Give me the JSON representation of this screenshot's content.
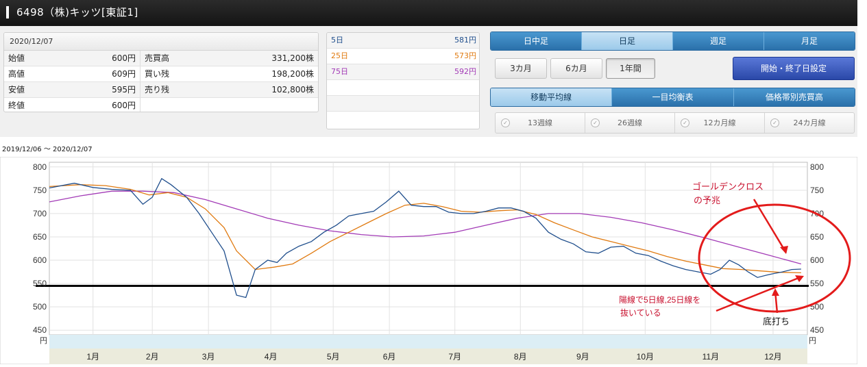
{
  "header": {
    "title": "6498（株)キッツ[東証1]"
  },
  "prices": {
    "date": "2020/12/07",
    "rows": [
      {
        "label": "始値",
        "value": "600円",
        "label2": "売買高",
        "value2": "331,200株"
      },
      {
        "label": "高値",
        "value": "609円",
        "label2": "買い残",
        "value2": "198,200株"
      },
      {
        "label": "安値",
        "value": "595円",
        "label2": "売り残",
        "value2": "102,800株"
      },
      {
        "label": "終値",
        "value": "600円",
        "label2": "",
        "value2": ""
      }
    ]
  },
  "ma_box": {
    "rows": [
      {
        "label": "5日",
        "value": "581円",
        "color": "#1f4e8c"
      },
      {
        "label": "25日",
        "value": "573円",
        "color": "#e07a10"
      },
      {
        "label": "75日",
        "value": "592円",
        "color": "#a23ab6"
      }
    ]
  },
  "period_tabs": [
    {
      "label": "日中足",
      "active": false
    },
    {
      "label": "日足",
      "active": true
    },
    {
      "label": "週足",
      "active": false
    },
    {
      "label": "月足",
      "active": false
    }
  ],
  "range_buttons": [
    {
      "label": "3カ月",
      "active": false
    },
    {
      "label": "6カ月",
      "active": false
    },
    {
      "label": "1年間",
      "active": true
    }
  ],
  "set_button": "開始・終了日設定",
  "indicator_tabs": [
    {
      "label": "移動平均線",
      "active": true
    },
    {
      "label": "一目均衡表",
      "active": false
    },
    {
      "label": "価格帯別売買高",
      "active": false
    }
  ],
  "checkboxes": [
    "13週線",
    "26週線",
    "12カ月線",
    "24カ月線"
  ],
  "range_text": "2019/12/06 〜 2020/12/07",
  "chart_data": {
    "type": "line",
    "unit": "円",
    "ylim": [
      440,
      810
    ],
    "yticks": [
      450,
      500,
      550,
      600,
      650,
      700,
      750,
      800
    ],
    "months": [
      "1月",
      "2月",
      "3月",
      "4月",
      "5月",
      "6月",
      "7月",
      "8月",
      "9月",
      "10月",
      "11月",
      "12月"
    ],
    "month_index": [
      14,
      33,
      51,
      71,
      91,
      109,
      130,
      151,
      171,
      191,
      212,
      232
    ],
    "total_days": 243,
    "horizontal_line": 545,
    "series": [
      {
        "name": "5日",
        "color": "#1f4e8c",
        "points": [
          [
            0,
            755
          ],
          [
            8,
            765
          ],
          [
            14,
            756
          ],
          [
            20,
            752
          ],
          [
            26,
            750
          ],
          [
            30,
            720
          ],
          [
            33,
            735
          ],
          [
            36,
            775
          ],
          [
            39,
            762
          ],
          [
            44,
            735
          ],
          [
            48,
            700
          ],
          [
            52,
            660
          ],
          [
            56,
            620
          ],
          [
            60,
            525
          ],
          [
            63,
            520
          ],
          [
            66,
            580
          ],
          [
            70,
            600
          ],
          [
            73,
            595
          ],
          [
            76,
            615
          ],
          [
            80,
            630
          ],
          [
            84,
            640
          ],
          [
            88,
            660
          ],
          [
            92,
            675
          ],
          [
            96,
            695
          ],
          [
            100,
            700
          ],
          [
            104,
            705
          ],
          [
            108,
            725
          ],
          [
            112,
            748
          ],
          [
            116,
            718
          ],
          [
            120,
            715
          ],
          [
            124,
            715
          ],
          [
            128,
            703
          ],
          [
            132,
            700
          ],
          [
            136,
            700
          ],
          [
            140,
            705
          ],
          [
            144,
            712
          ],
          [
            148,
            712
          ],
          [
            152,
            705
          ],
          [
            156,
            690
          ],
          [
            160,
            660
          ],
          [
            164,
            645
          ],
          [
            168,
            635
          ],
          [
            172,
            618
          ],
          [
            176,
            615
          ],
          [
            180,
            628
          ],
          [
            184,
            630
          ],
          [
            188,
            615
          ],
          [
            192,
            610
          ],
          [
            196,
            598
          ],
          [
            200,
            588
          ],
          [
            204,
            580
          ],
          [
            208,
            575
          ],
          [
            212,
            570
          ],
          [
            215,
            580
          ],
          [
            218,
            600
          ],
          [
            221,
            590
          ],
          [
            224,
            575
          ],
          [
            227,
            563
          ],
          [
            230,
            568
          ],
          [
            232,
            571
          ],
          [
            235,
            575
          ],
          [
            238,
            580
          ],
          [
            241,
            581
          ]
        ]
      },
      {
        "name": "25日",
        "color": "#e07a10",
        "points": [
          [
            0,
            758
          ],
          [
            10,
            762
          ],
          [
            18,
            760
          ],
          [
            26,
            752
          ],
          [
            32,
            740
          ],
          [
            38,
            745
          ],
          [
            44,
            735
          ],
          [
            50,
            710
          ],
          [
            56,
            670
          ],
          [
            60,
            620
          ],
          [
            66,
            580
          ],
          [
            72,
            585
          ],
          [
            78,
            592
          ],
          [
            84,
            615
          ],
          [
            90,
            640
          ],
          [
            96,
            660
          ],
          [
            102,
            680
          ],
          [
            108,
            700
          ],
          [
            114,
            718
          ],
          [
            120,
            722
          ],
          [
            126,
            715
          ],
          [
            132,
            705
          ],
          [
            138,
            703
          ],
          [
            144,
            706
          ],
          [
            150,
            708
          ],
          [
            156,
            698
          ],
          [
            162,
            680
          ],
          [
            168,
            665
          ],
          [
            174,
            650
          ],
          [
            180,
            640
          ],
          [
            186,
            630
          ],
          [
            192,
            620
          ],
          [
            198,
            608
          ],
          [
            204,
            598
          ],
          [
            210,
            590
          ],
          [
            216,
            582
          ],
          [
            222,
            580
          ],
          [
            228,
            577
          ],
          [
            234,
            574
          ],
          [
            241,
            573
          ]
        ]
      },
      {
        "name": "75日",
        "color": "#a23ab6",
        "points": [
          [
            0,
            725
          ],
          [
            10,
            738
          ],
          [
            20,
            748
          ],
          [
            30,
            748
          ],
          [
            40,
            745
          ],
          [
            50,
            730
          ],
          [
            60,
            710
          ],
          [
            70,
            690
          ],
          [
            80,
            675
          ],
          [
            90,
            663
          ],
          [
            100,
            655
          ],
          [
            110,
            650
          ],
          [
            120,
            652
          ],
          [
            130,
            660
          ],
          [
            140,
            675
          ],
          [
            150,
            690
          ],
          [
            160,
            700
          ],
          [
            170,
            700
          ],
          [
            180,
            692
          ],
          [
            190,
            680
          ],
          [
            200,
            665
          ],
          [
            210,
            648
          ],
          [
            220,
            630
          ],
          [
            230,
            612
          ],
          [
            241,
            592
          ]
        ]
      }
    ]
  },
  "annotations": [
    {
      "text": "ゴールデンクロス"
    },
    {
      "text": "の予兆"
    },
    {
      "text": "陽線で5日線,25日線を"
    },
    {
      "text": "抜いている"
    },
    {
      "text": "底打ち"
    }
  ]
}
